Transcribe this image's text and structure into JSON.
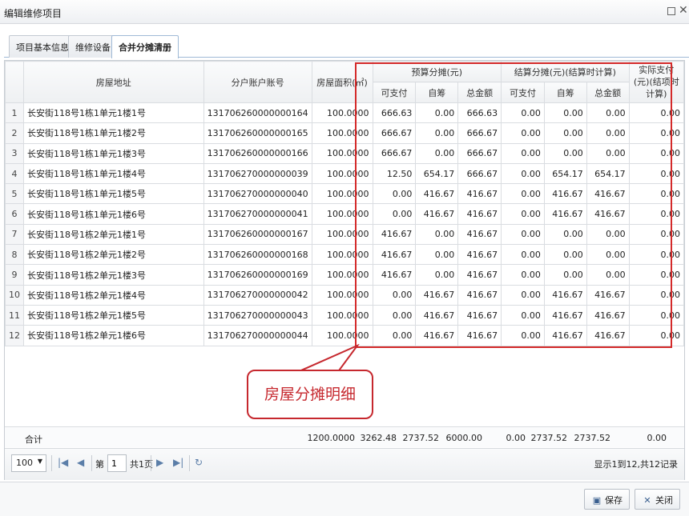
{
  "window": {
    "title": "编辑维修项目"
  },
  "tabs": [
    {
      "label": "项目基本信息"
    },
    {
      "label": "维修设备"
    },
    {
      "label": "合并分摊清册"
    }
  ],
  "grid": {
    "headers": {
      "address": "房屋地址",
      "account": "分户账户账号",
      "area": "房屋面积(㎡)",
      "budget_group": "预算分摊(元)",
      "settle_group": "结算分摊(元)(结算时计算)",
      "actual_group": "实际支付(元)(结项时计算)",
      "payable": "可支付",
      "self_raised": "自筹",
      "total": "总金额"
    },
    "rows": [
      [
        "1",
        "长安街118号1栋1单元1楼1号",
        "131706260000000164",
        "100.0000",
        "666.63",
        "0.00",
        "666.63",
        "0.00",
        "0.00",
        "0.00",
        "0.00"
      ],
      [
        "2",
        "长安街118号1栋1单元1楼2号",
        "131706260000000165",
        "100.0000",
        "666.67",
        "0.00",
        "666.67",
        "0.00",
        "0.00",
        "0.00",
        "0.00"
      ],
      [
        "3",
        "长安街118号1栋1单元1楼3号",
        "131706260000000166",
        "100.0000",
        "666.67",
        "0.00",
        "666.67",
        "0.00",
        "0.00",
        "0.00",
        "0.00"
      ],
      [
        "4",
        "长安街118号1栋1单元1楼4号",
        "131706270000000039",
        "100.0000",
        "12.50",
        "654.17",
        "666.67",
        "0.00",
        "654.17",
        "654.17",
        "0.00"
      ],
      [
        "5",
        "长安街118号1栋1单元1楼5号",
        "131706270000000040",
        "100.0000",
        "0.00",
        "416.67",
        "416.67",
        "0.00",
        "416.67",
        "416.67",
        "0.00"
      ],
      [
        "6",
        "长安街118号1栋1单元1楼6号",
        "131706270000000041",
        "100.0000",
        "0.00",
        "416.67",
        "416.67",
        "0.00",
        "416.67",
        "416.67",
        "0.00"
      ],
      [
        "7",
        "长安街118号1栋2单元1楼1号",
        "131706260000000167",
        "100.0000",
        "416.67",
        "0.00",
        "416.67",
        "0.00",
        "0.00",
        "0.00",
        "0.00"
      ],
      [
        "8",
        "长安街118号1栋2单元1楼2号",
        "131706260000000168",
        "100.0000",
        "416.67",
        "0.00",
        "416.67",
        "0.00",
        "0.00",
        "0.00",
        "0.00"
      ],
      [
        "9",
        "长安街118号1栋2单元1楼3号",
        "131706260000000169",
        "100.0000",
        "416.67",
        "0.00",
        "416.67",
        "0.00",
        "0.00",
        "0.00",
        "0.00"
      ],
      [
        "10",
        "长安街118号1栋2单元1楼4号",
        "131706270000000042",
        "100.0000",
        "0.00",
        "416.67",
        "416.67",
        "0.00",
        "416.67",
        "416.67",
        "0.00"
      ],
      [
        "11",
        "长安街118号1栋2单元1楼5号",
        "131706270000000043",
        "100.0000",
        "0.00",
        "416.67",
        "416.67",
        "0.00",
        "416.67",
        "416.67",
        "0.00"
      ],
      [
        "12",
        "长安街118号1栋2单元1楼6号",
        "131706270000000044",
        "100.0000",
        "0.00",
        "416.67",
        "416.67",
        "0.00",
        "416.67",
        "416.67",
        "0.00"
      ]
    ],
    "totals": {
      "label": "合计",
      "area": "1200.0000",
      "budget_payable": "3262.48",
      "budget_self": "2737.52",
      "budget_total": "6000.00",
      "settle_payable": "0.00",
      "settle_self": "2737.52",
      "settle_total": "2737.52",
      "actual": "0.00"
    }
  },
  "pager": {
    "page_size": "100",
    "page_prefix": "第",
    "page_value": "1",
    "page_suffix": "共1页",
    "info": "显示1到12,共12记录"
  },
  "annotation": {
    "callout_text": "房屋分摊明细",
    "color": "#d42a2a"
  },
  "footer": {
    "save_label": "保存",
    "close_label": "关闭"
  },
  "colors": {
    "accent": "#5b7ea8",
    "border": "#dadde1"
  }
}
